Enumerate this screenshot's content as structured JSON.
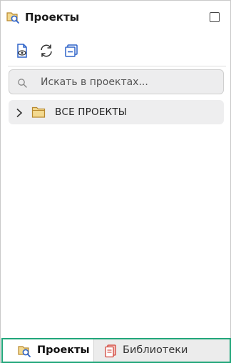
{
  "header": {
    "title": "Проекты",
    "icon": "projects-search-icon"
  },
  "toolbar": {
    "buttons": [
      {
        "name": "view-document-icon"
      },
      {
        "name": "refresh-icon"
      },
      {
        "name": "collapse-all-icon"
      }
    ]
  },
  "search": {
    "placeholder": "Искать в проектах...",
    "value": ""
  },
  "tree": {
    "items": [
      {
        "label": "ВСЕ ПРОЕКТЫ",
        "expanded": false,
        "icon": "folder-icon"
      }
    ]
  },
  "tabs": [
    {
      "label": "Проекты",
      "active": true,
      "icon": "projects-search-icon"
    },
    {
      "label": "Библиотеки",
      "active": false,
      "icon": "libraries-icon"
    }
  ],
  "colors": {
    "active_tab_border": "#21a67a",
    "icon_blue": "#2e63c9",
    "folder": "#d9b66a",
    "library_red": "#d2453b"
  }
}
